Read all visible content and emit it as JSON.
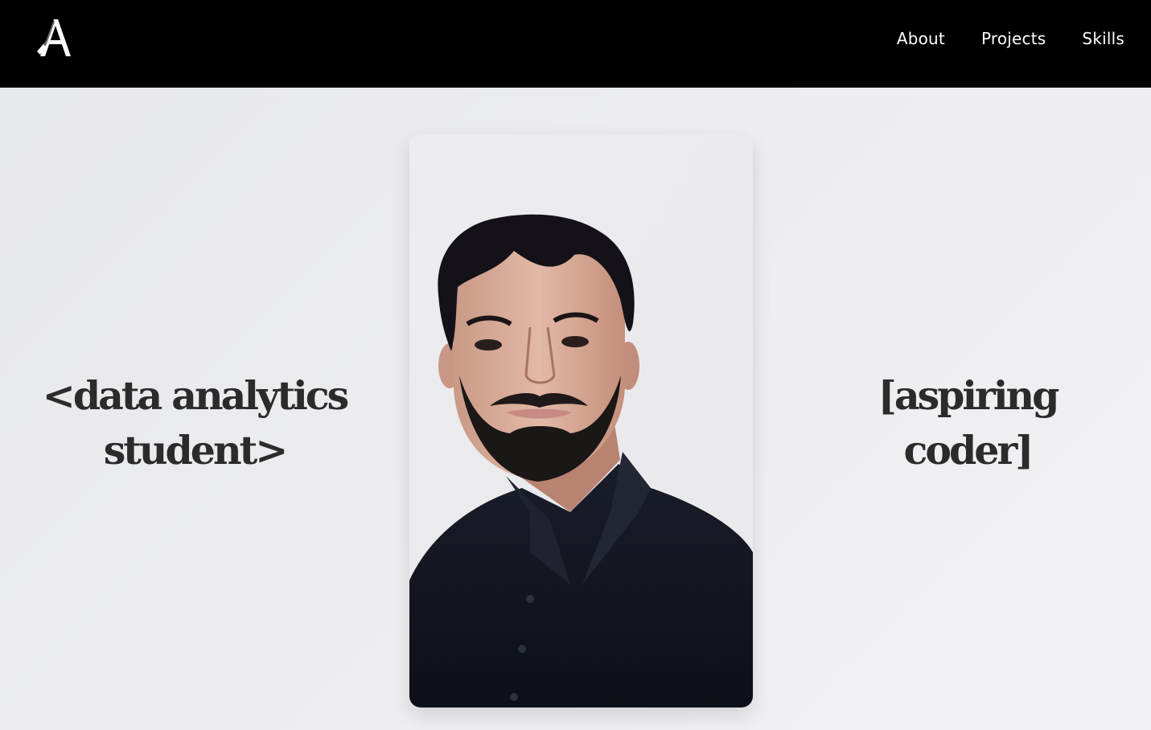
{
  "header": {
    "logo_text": "A",
    "logo_icon": "monogram-a-logo",
    "nav": [
      {
        "label": "About"
      },
      {
        "label": "Projects"
      },
      {
        "label": "Skills"
      }
    ]
  },
  "hero": {
    "left_tagline": {
      "line1": "<data analytics",
      "line2": "student>"
    },
    "right_tagline": {
      "line1": "[aspiring",
      "line2": "coder]"
    },
    "portrait_alt": "portrait photo of a young man in a dark shirt"
  },
  "colors": {
    "navbar_bg": "#000000",
    "nav_text": "#ffffff",
    "page_bg": "#ececef",
    "tagline_text": "#2b2b2b"
  }
}
